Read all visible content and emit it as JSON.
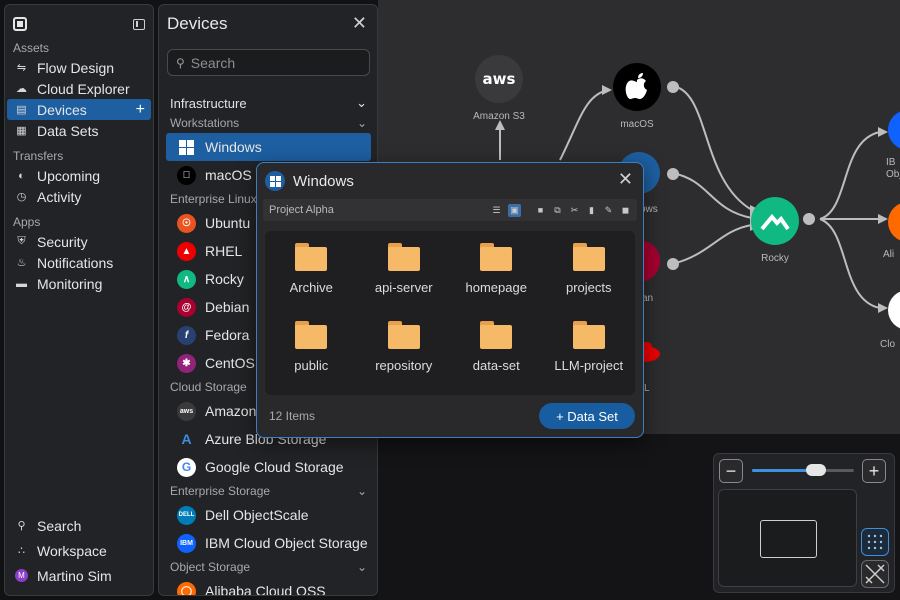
{
  "nav": {
    "sections": [
      {
        "title": "Assets",
        "items": [
          {
            "label": "Flow Design",
            "icon": "flow-icon"
          },
          {
            "label": "Cloud Explorer",
            "icon": "cloud-icon"
          },
          {
            "label": "Devices",
            "icon": "devices-icon",
            "active": true
          },
          {
            "label": "Data Sets",
            "icon": "dataset-icon"
          }
        ]
      },
      {
        "title": "Transfers",
        "items": [
          {
            "label": "Upcoming",
            "icon": "clock-icon"
          },
          {
            "label": "Activity",
            "icon": "activity-icon"
          }
        ]
      },
      {
        "title": "Apps",
        "items": [
          {
            "label": "Security",
            "icon": "shield-icon"
          },
          {
            "label": "Notifications",
            "icon": "bell-icon"
          },
          {
            "label": "Monitoring",
            "icon": "monitor-icon"
          }
        ]
      }
    ],
    "bottom": {
      "search": "Search",
      "workspace": "Workspace",
      "user": "Martino Sim"
    }
  },
  "devices": {
    "title": "Devices",
    "search_placeholder": "Search",
    "group_infrastructure": "Infrastructure",
    "group_workstations": "Workstations",
    "row_windows": "Windows",
    "row_macos": "macOS",
    "group_enterprise_linux": "Enterprise Linux",
    "row_ubuntu": "Ubuntu",
    "row_rhel": "RHEL",
    "row_rocky": "Rocky",
    "row_debian": "Debian",
    "row_fedora": "Fedora",
    "row_centos": "CentOS",
    "group_cloud_storage": "Cloud Storage",
    "row_amazon": "Amazon S3",
    "row_azure": "Azure Blob Storage",
    "row_gcs": "Google Cloud Storage",
    "group_enterprise_storage": "Enterprise Storage",
    "row_dell": "Dell ObjectScale",
    "row_ibm": "IBM Cloud Object Storage",
    "group_object_storage": "Object Storage",
    "row_alibaba": "Alibaba Cloud OSS"
  },
  "popup": {
    "title": "Windows",
    "path": "Project Alpha",
    "folders": [
      "Archive",
      "api-server",
      "homepage",
      "projects",
      "public",
      "repository",
      "data-set",
      "LLM-project"
    ],
    "item_count": "12 Items",
    "add_label": "+ Data Set"
  },
  "canvas": {
    "node_amazon": "Amazon S3",
    "node_macos": "macOS",
    "node_rocky": "Rocky",
    "node_windows_partial": "ows",
    "node_debian_partial": "an",
    "node_rhel_partial": "L",
    "node_ibm_partial": "IB\nObj",
    "node_alibaba_partial": "Ali",
    "node_cloud_partial": "Clo",
    "zoom_level": 0.63
  },
  "colors": {
    "accent": "#1d5fa1",
    "popup_border": "#3b7fc4",
    "folder": "#f6b968",
    "rocky": "#10b981",
    "ubuntu": "#e95420",
    "rhel": "#ee0000",
    "debian": "#a80030",
    "fedora": "#294172",
    "centos": "#932279"
  }
}
